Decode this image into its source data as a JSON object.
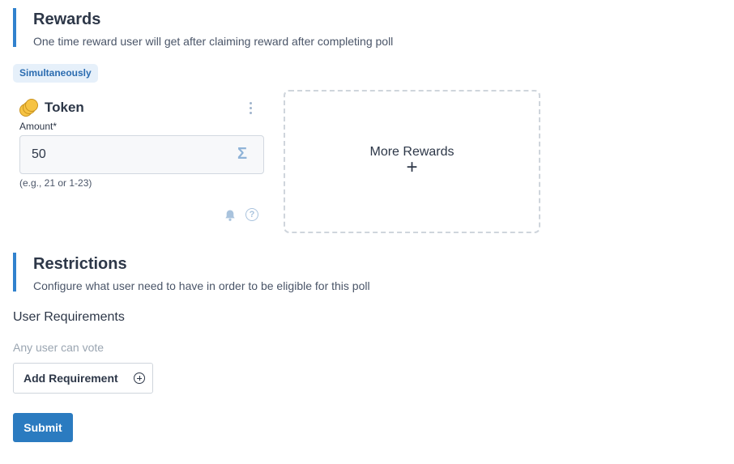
{
  "rewards_section": {
    "title": "Rewards",
    "description": "One time reward user will get after claiming reward after completing poll"
  },
  "reward_mode_badge": "Simultaneously",
  "reward_card": {
    "name": "Token",
    "icon": "coins-icon",
    "amount_label": "Amount",
    "amount_required": "*",
    "amount_value": "50",
    "amount_icon": "sigma-icon",
    "amount_hint": "(e.g., 21 or 1-23)"
  },
  "more_rewards": {
    "label": "More Rewards",
    "icon": "plus-icon"
  },
  "restrictions_section": {
    "title": "Restrictions",
    "description": "Configure what user need to have in order to be eligible for this poll"
  },
  "user_requirements": {
    "title": "User Requirements",
    "empty_text": "Any user can vote",
    "add_button": "Add Requirement"
  },
  "submit_label": "Submit",
  "colors": {
    "accent": "#3182ce",
    "primary_button": "#2b7bc0",
    "badge_bg": "#e6f0fa"
  }
}
